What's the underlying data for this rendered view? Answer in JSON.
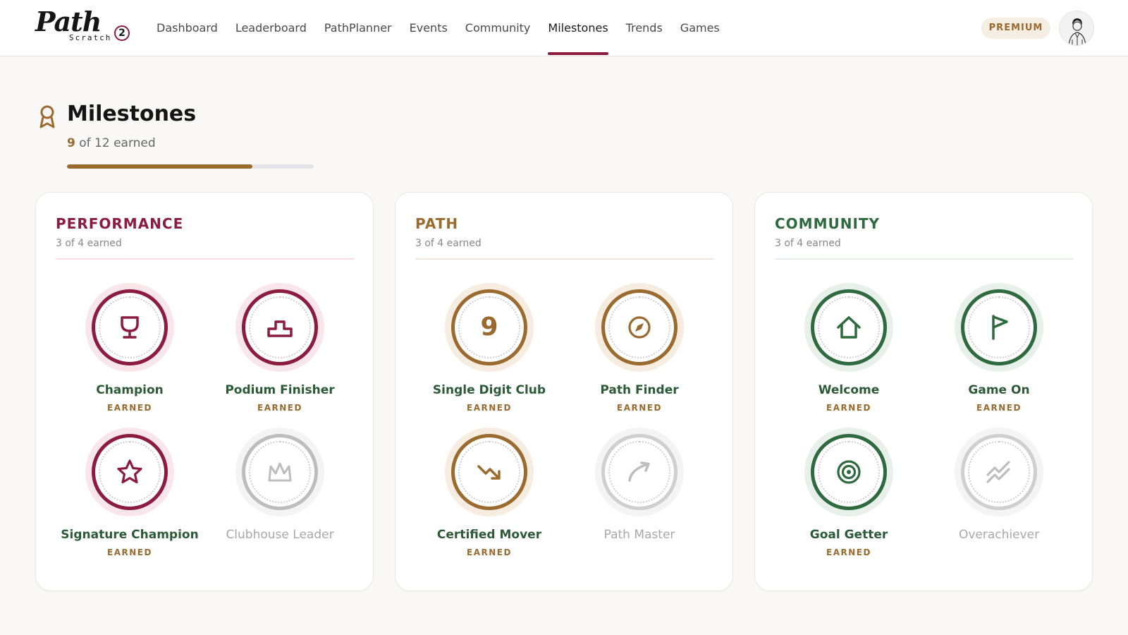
{
  "app": {
    "logo_word": "Path",
    "logo_sub": "Scratch",
    "logo_number": "2"
  },
  "nav": {
    "items": [
      {
        "label": "Dashboard"
      },
      {
        "label": "Leaderboard"
      },
      {
        "label": "PathPlanner"
      },
      {
        "label": "Events"
      },
      {
        "label": "Community"
      },
      {
        "label": "Milestones"
      },
      {
        "label": "Trends"
      },
      {
        "label": "Games"
      }
    ],
    "active": "Milestones"
  },
  "header": {
    "premium_label": "PREMIUM"
  },
  "page": {
    "title": "Milestones",
    "earned_count": "9",
    "earned_rest": "of 12 earned",
    "progress_fraction": 0.75
  },
  "colors": {
    "performance": "#8c1b40",
    "path": "#9a6a2f",
    "community": "#2e6a3e",
    "locked": "#bdbdbd",
    "text_green": "#2b5a36",
    "gold": "#9a6a2f"
  },
  "categories": [
    {
      "title": "PERFORMANCE",
      "earned_text": "3 of 4 earned",
      "badges": [
        {
          "name": "Champion",
          "state": "EARNED",
          "earned": true,
          "icon": "trophy-icon"
        },
        {
          "name": "Podium Finisher",
          "state": "EARNED",
          "earned": true,
          "icon": "podium-icon"
        },
        {
          "name": "Signature Champion",
          "state": "EARNED",
          "earned": true,
          "icon": "star-icon"
        },
        {
          "name": "Clubhouse Leader",
          "state": "",
          "earned": false,
          "icon": "crown-icon"
        }
      ]
    },
    {
      "title": "PATH",
      "earned_text": "3 of 4 earned",
      "badges": [
        {
          "name": "Single Digit Club",
          "state": "EARNED",
          "earned": true,
          "icon": "nine-digit",
          "glyph": "9"
        },
        {
          "name": "Path Finder",
          "state": "EARNED",
          "earned": true,
          "icon": "compass-icon"
        },
        {
          "name": "Certified Mover",
          "state": "EARNED",
          "earned": true,
          "icon": "trend-down-icon"
        },
        {
          "name": "Path Master",
          "state": "",
          "earned": false,
          "icon": "curve-arrow-icon"
        }
      ]
    },
    {
      "title": "COMMUNITY",
      "earned_text": "3 of 4 earned",
      "badges": [
        {
          "name": "Welcome",
          "state": "EARNED",
          "earned": true,
          "icon": "home-icon"
        },
        {
          "name": "Game On",
          "state": "EARNED",
          "earned": true,
          "icon": "flag-icon"
        },
        {
          "name": "Goal Getter",
          "state": "EARNED",
          "earned": true,
          "icon": "target-icon"
        },
        {
          "name": "Overachiever",
          "state": "",
          "earned": false,
          "icon": "double-chevron-icon"
        }
      ]
    }
  ]
}
